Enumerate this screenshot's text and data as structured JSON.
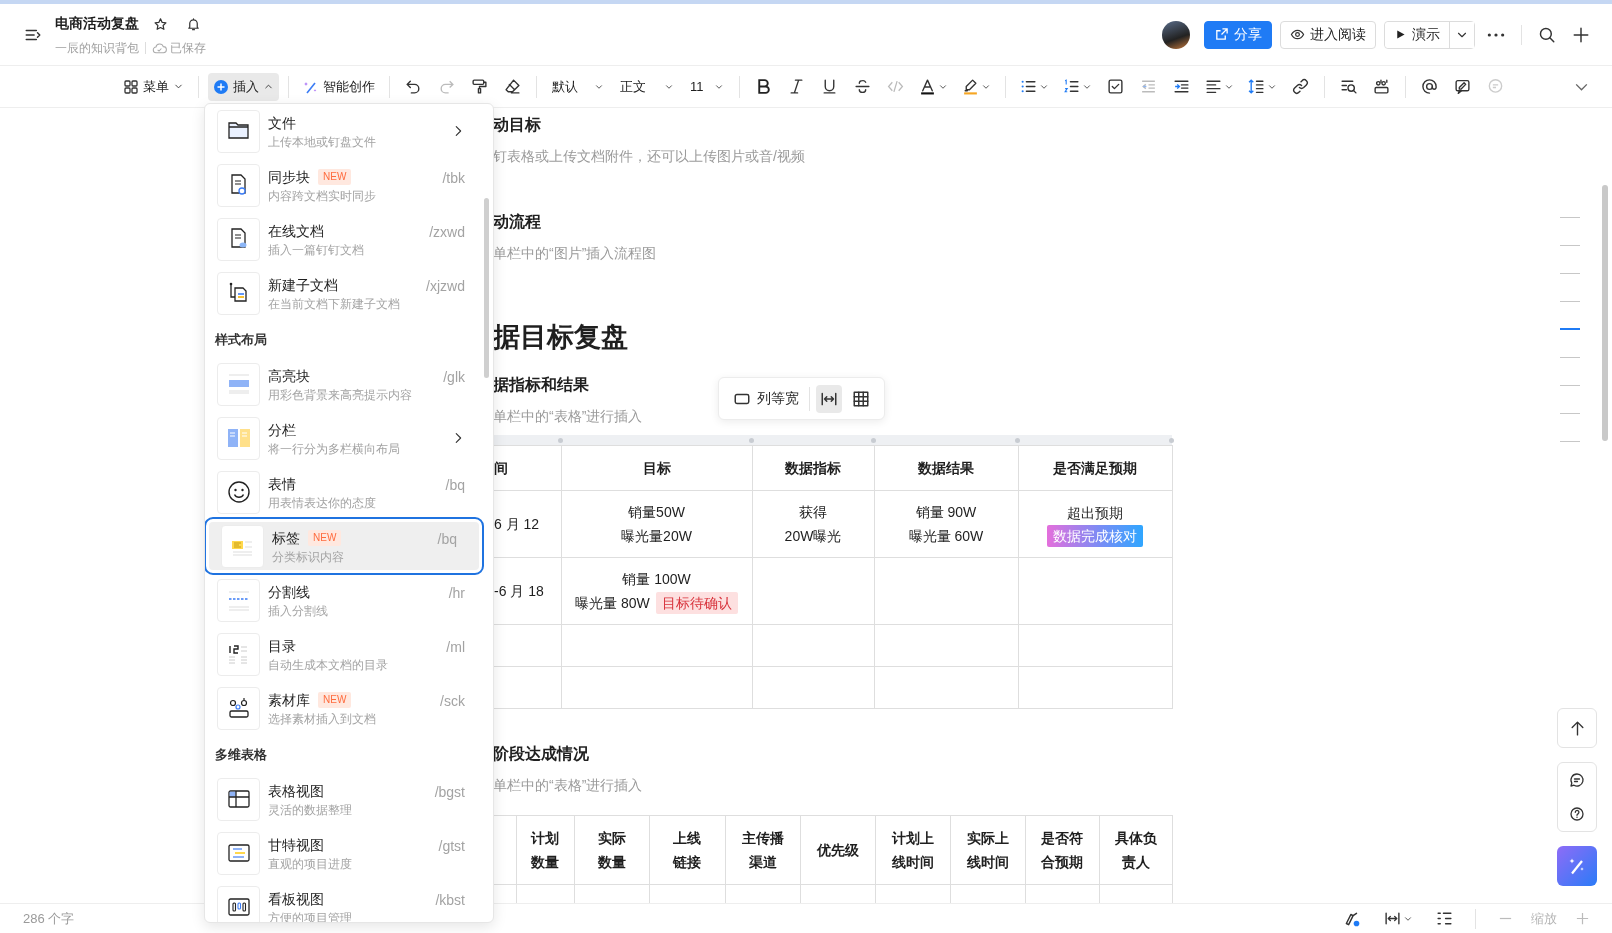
{
  "header": {
    "title": "电商活动复盘",
    "space": "一辰的知识背包",
    "save_status": "已保存",
    "share_label": "分享",
    "read_label": "进入阅读",
    "present_label": "演示"
  },
  "toolbar": {
    "menu_label": "菜单",
    "insert": {
      "label": "插入",
      "expanded": true
    },
    "ai_label": "智能创作",
    "style": "默认",
    "paragraph": "正文",
    "font_size": "11"
  },
  "insert_menu": {
    "sections": [
      {
        "items": [
          {
            "kind": "file",
            "title": "文件",
            "description": "上传本地或钉盘文件",
            "submenu": true,
            "selected": false
          },
          {
            "kind": "sync",
            "title": "同步块",
            "badge": "NEW",
            "description": "内容跨文档实时同步",
            "shortcut": "/tbk",
            "selected": false
          },
          {
            "kind": "doc",
            "title": "在线文档",
            "description": "插入一篇钉钉文档",
            "shortcut": "/zxwd",
            "selected": false
          },
          {
            "kind": "subdoc",
            "title": "新建子文档",
            "description": "在当前文档下新建子文档",
            "shortcut": "/xjzwd",
            "selected": false
          }
        ]
      },
      {
        "heading": "样式布局",
        "items": [
          {
            "kind": "highlight",
            "title": "高亮块",
            "description": "用彩色背景来高亮提示内容",
            "shortcut": "/glk",
            "selected": false
          },
          {
            "kind": "columns",
            "title": "分栏",
            "description": "将一行分为多栏横向布局",
            "submenu": true,
            "selected": false
          },
          {
            "kind": "emoji",
            "title": "表情",
            "description": "用表情表达你的态度",
            "shortcut": "/bq",
            "selected": false
          },
          {
            "kind": "tag",
            "title": "标签",
            "badge": "NEW",
            "description": "分类标识内容",
            "shortcut": "/bq",
            "selected": true
          },
          {
            "kind": "divider",
            "title": "分割线",
            "description": "插入分割线",
            "shortcut": "/hr",
            "selected": false
          },
          {
            "kind": "toc",
            "title": "目录",
            "description": "自动生成本文档的目录",
            "shortcut": "/ml",
            "selected": false
          },
          {
            "kind": "materials",
            "title": "素材库",
            "badge": "NEW",
            "description": "选择素材插入到文档",
            "shortcut": "/sck",
            "selected": false
          }
        ]
      },
      {
        "heading": "多维表格",
        "items": [
          {
            "kind": "gridview",
            "title": "表格视图",
            "description": "灵活的数据整理",
            "shortcut": "/bgst",
            "selected": false
          },
          {
            "kind": "gantt",
            "title": "甘特视图",
            "description": "直观的项目进度",
            "shortcut": "/gtst",
            "selected": false
          },
          {
            "kind": "kanban",
            "title": "看板视图",
            "description": "方便的项目管理",
            "shortcut": "/kbst",
            "selected": false
          }
        ]
      }
    ]
  },
  "document": {
    "blocks": [
      {
        "kind": "heading3",
        "text": "动目标"
      },
      {
        "kind": "hint",
        "text": "钉表格或上传文档附件，还可以上传图片或音/视频"
      },
      {
        "kind": "heading3",
        "text": "动流程"
      },
      {
        "kind": "hint",
        "text": "单栏中的“图片”插入流程图"
      },
      {
        "kind": "heading1",
        "text": "据目标复盘"
      },
      {
        "kind": "heading3",
        "text": "据指标和结果"
      },
      {
        "kind": "hint",
        "text": "单栏中的“表格”进行插入"
      },
      {
        "kind": "table",
        "selected": true,
        "toolbar": {
          "label": "列等宽",
          "fit_width_selected": true
        },
        "columns": [
          "间",
          "目标",
          "数据指标",
          "数据结果",
          "是否满足预期"
        ],
        "rows": [
          [
            [
              {
                "text": "6 月 12"
              }
            ],
            [
              {
                "text": "销量50W"
              },
              {
                "text": "曝光量20W"
              }
            ],
            [
              {
                "text": "获得"
              },
              {
                "text": "20W曝光"
              }
            ],
            [
              {
                "text": "销量 90W"
              },
              {
                "text": "曝光量 60W"
              }
            ],
            [
              {
                "text": "超出预期"
              },
              {
                "tag": {
                  "kind": "gradient",
                  "text": "数据完成核对"
                }
              }
            ]
          ],
          [
            [
              {
                "text": "-6 月 18"
              }
            ],
            [
              {
                "text": "销量 100W"
              },
              {
                "text": "曝光量 80W",
                "tag": {
                  "kind": "warning",
                  "text": "目标待确认"
                }
              }
            ],
            null,
            null,
            null
          ],
          [
            null,
            null,
            null,
            null,
            null
          ],
          [
            null,
            null,
            null,
            null,
            null
          ]
        ]
      },
      {
        "kind": "heading3",
        "text": "阶段达成情况"
      },
      {
        "kind": "hint",
        "text": "单栏中的“表格”进行插入"
      },
      {
        "kind": "table",
        "selected": false,
        "columns": [
          null,
          "计划数量",
          "实际数量",
          "上线链接",
          "主传播渠道",
          "优先级",
          "计划上线时间",
          "实际上线时间",
          "是否符合预期",
          "具体负责人"
        ],
        "rows": [
          [
            null,
            null,
            null,
            null,
            null,
            null,
            null,
            null,
            null,
            null
          ]
        ]
      }
    ]
  },
  "outline": [
    {
      "selected": false
    },
    {
      "selected": false
    },
    {
      "selected": false
    },
    {
      "selected": false
    },
    {
      "selected": true
    },
    {
      "selected": false
    },
    {
      "selected": false
    },
    {
      "selected": false
    },
    {
      "selected": false
    }
  ],
  "status_bar": {
    "word_count": "286 个字",
    "zoom_label": "缩放"
  }
}
